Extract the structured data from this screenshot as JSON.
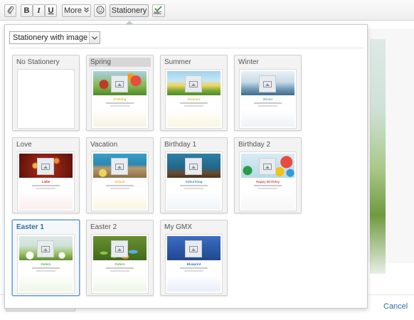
{
  "toolbar": {
    "buttons": [
      {
        "label": "",
        "icon": "paperclip-icon"
      },
      {
        "label": "B"
      },
      {
        "label": "I"
      },
      {
        "label": "U"
      },
      {
        "label": "More",
        "icon": "double-chevron-down-icon"
      },
      {
        "label": "",
        "icon": "smiley-icon"
      },
      {
        "label": "Stationery"
      },
      {
        "label": "",
        "icon": "spellcheck-abc-icon",
        "icon_text": "ABC"
      }
    ]
  },
  "stationery_popup": {
    "select_value": "Stationery with image",
    "items": [
      {
        "label": "No Stationery",
        "thumb_title": "",
        "accent": "#ffffff"
      },
      {
        "label": "Spring",
        "thumb_title": "Frühling",
        "accent": "#e7b84a"
      },
      {
        "label": "Summer",
        "thumb_title": "Sommer",
        "accent": "#e7b84a"
      },
      {
        "label": "Winter",
        "thumb_title": "Winter",
        "accent": "#7aa6c8"
      },
      {
        "label": "Love",
        "thumb_title": "Liebe",
        "accent": "#c9302c"
      },
      {
        "label": "Vacation",
        "thumb_title": "Urlaub",
        "accent": "#e7b84a"
      },
      {
        "label": "Birthday 1",
        "thumb_title": "Geburtstag",
        "accent": "#4a8fb8"
      },
      {
        "label": "Birthday 2",
        "thumb_title": "Happy Birthday",
        "accent": "#d9534f"
      },
      {
        "label": "Easter 1",
        "thumb_title": "Ostern",
        "accent": "#6aa84f"
      },
      {
        "label": "Easter 2",
        "thumb_title": "Ostern",
        "accent": "#6aa84f"
      },
      {
        "label": "My GMX",
        "thumb_title": "Blueprint",
        "accent": "#2f6fcf"
      }
    ],
    "selected": "Easter 1",
    "hovered": "Spring"
  },
  "footer": {
    "cancel_label": "Cancel"
  },
  "colors": {
    "link": "#2d6ea7",
    "selected_border": "#6f9fcf"
  }
}
